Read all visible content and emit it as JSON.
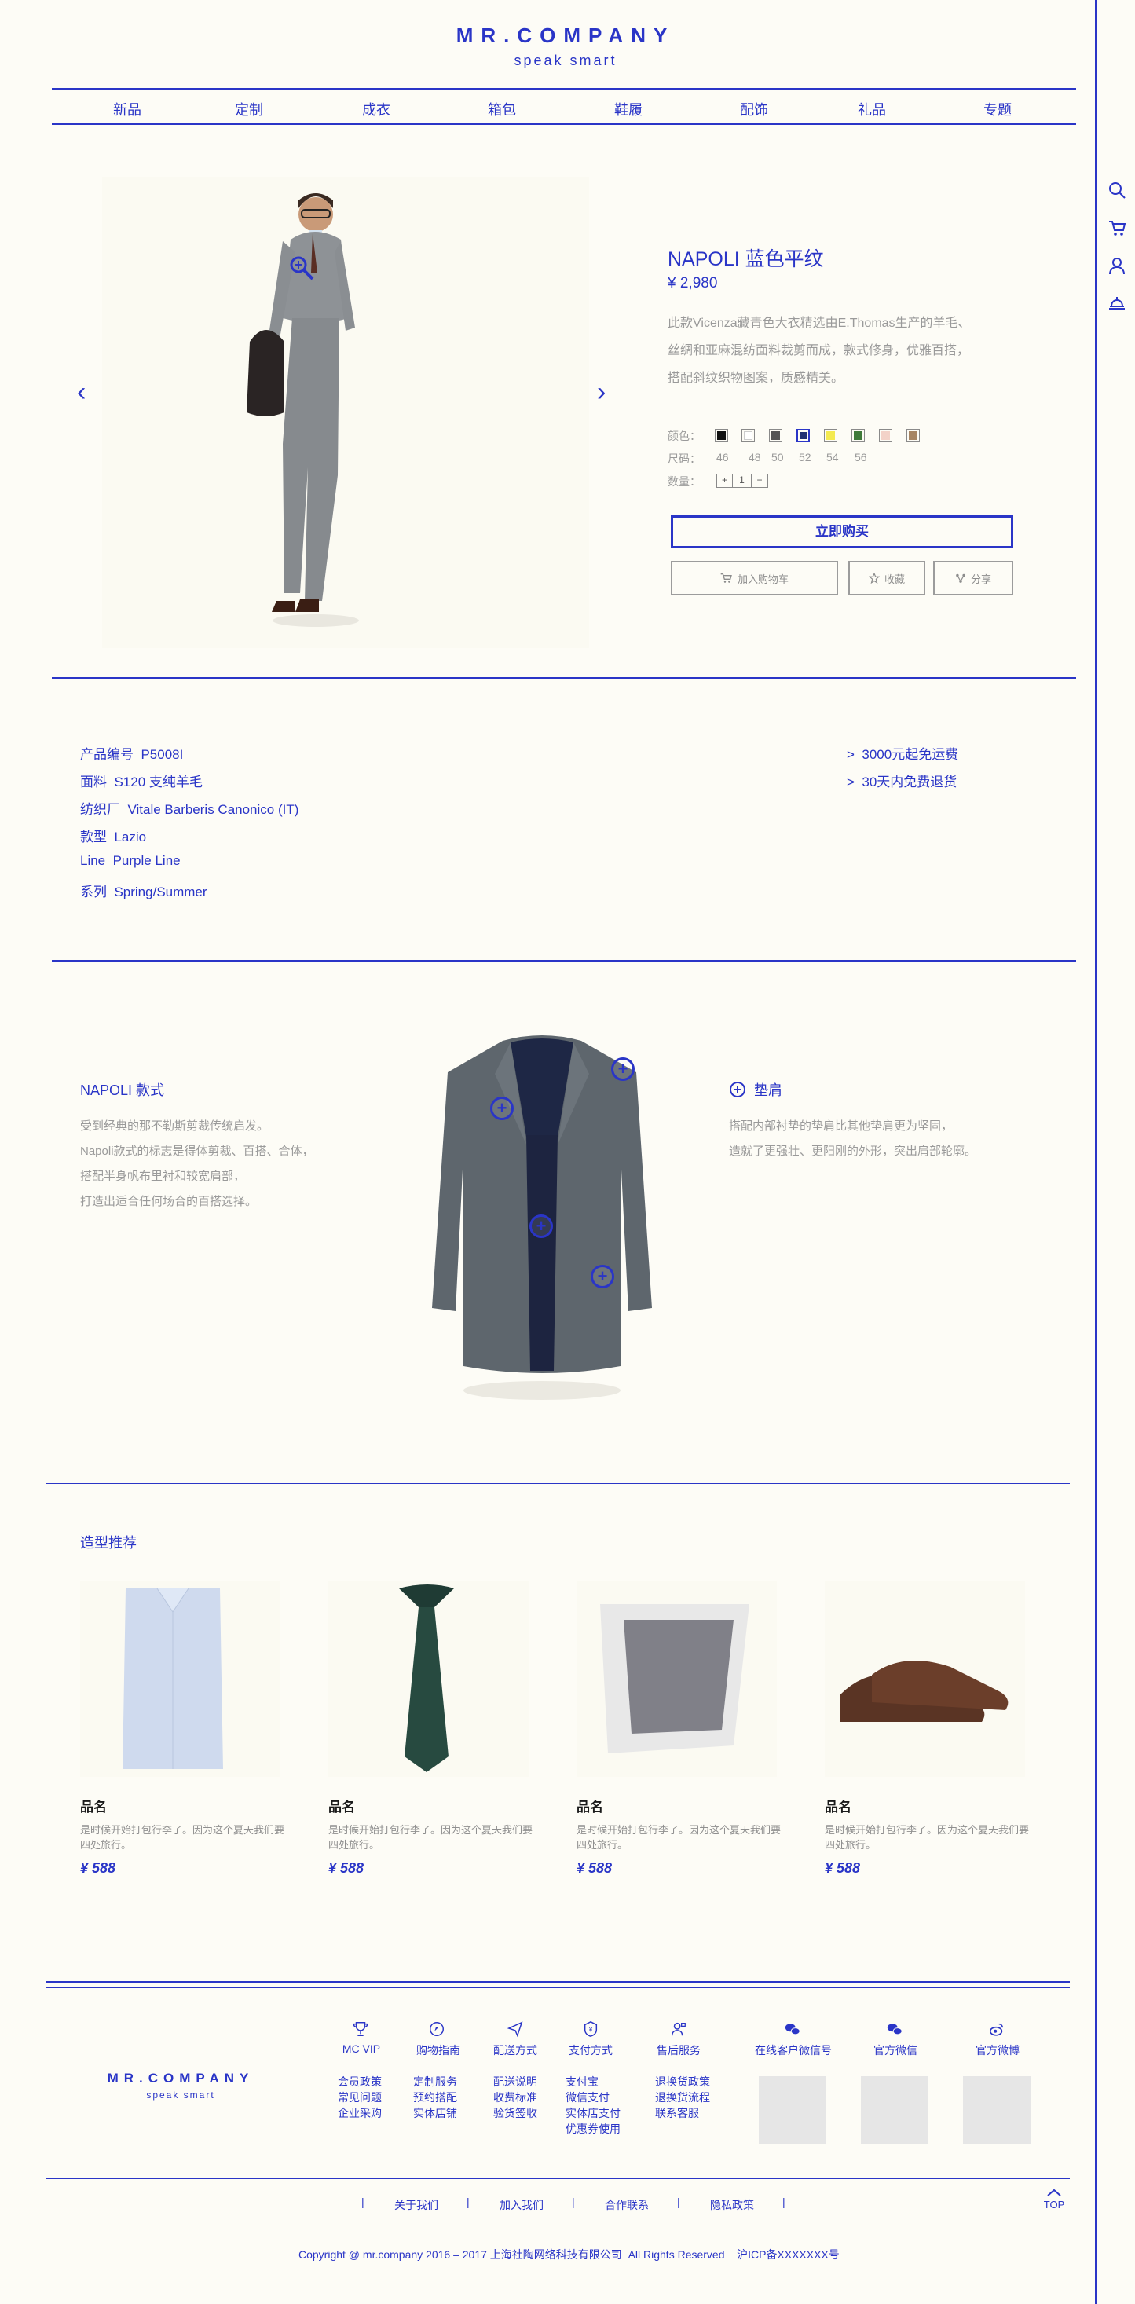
{
  "brand": {
    "logo": "MR.COMPANY",
    "tagline": "speak smart",
    "color": "#2a35c7"
  },
  "nav": [
    "新品",
    "定制",
    "成衣",
    "箱包",
    "鞋履",
    "配饰",
    "礼品",
    "专题"
  ],
  "rail_icons": [
    "search-icon",
    "cart-icon",
    "user-icon",
    "service-bell-icon"
  ],
  "product": {
    "name": "NAPOLI 蓝色平纹",
    "price": "¥ 2,980",
    "desc_lines": [
      "此款Vicenza藏青色大衣精选由E.Thomas生产的羊毛、",
      "丝绸和亚麻混纺面料裁剪而成，款式修身，优雅百搭，",
      "搭配斜纹织物图案，质感精美。"
    ],
    "color_label": "颜色：",
    "size_label": "尺码：",
    "qty_label": "数量：",
    "colors": [
      "#111111",
      "#ffffff",
      "#555555",
      "#1f2f73",
      "#f4ea50",
      "#3f7a3a",
      "#f3d2c8",
      "#a78563"
    ],
    "sizes": [
      "46",
      "48",
      "50",
      "52",
      "54",
      "56"
    ],
    "qty": {
      "minus": "+",
      "value": "1",
      "plus": "−"
    },
    "buy_now": "立即购买",
    "add_cart": "加入购物车",
    "favorite": "收藏",
    "share": "分享",
    "prev_arrow": "‹",
    "next_arrow": "›"
  },
  "specs": [
    {
      "label": "产品编号",
      "value": "P5008I"
    },
    {
      "label": "面料",
      "value": "S120 支纯羊毛"
    },
    {
      "label": "纺织厂",
      "value": "Vitale Barberis Canonico (IT)"
    },
    {
      "label": "款型",
      "value": "Lazio"
    },
    {
      "label": "Line",
      "value": "Purple Line"
    },
    {
      "label": "系列",
      "value": "Spring/Summer"
    }
  ],
  "perks": [
    "3000元起免运费",
    "30天内免费退货"
  ],
  "perk_marker": ">",
  "style": {
    "title": "NAPOLI 款式",
    "lines": [
      "受到经典的那不勒斯剪裁传统启发。",
      "Napoli款式的标志是得体剪裁、百搭、合体，",
      "搭配半身帆布里衬和较宽肩部，",
      "打造出适合任何场合的百搭选择。"
    ],
    "feature_title": "垫肩",
    "feature_lines": [
      "搭配内部衬垫的垫肩比其他垫肩更为坚固，",
      "造就了更强壮、更阳刚的外形，突出肩部轮廓。"
    ]
  },
  "recommend": {
    "title": "造型推荐",
    "items": [
      {
        "name": "品名",
        "desc": "是时候开始打包行李了。因为这个夏天我们要四处旅行。",
        "price": "¥ 588"
      },
      {
        "name": "品名",
        "desc": "是时候开始打包行李了。因为这个夏天我们要四处旅行。",
        "price": "¥ 588"
      },
      {
        "name": "品名",
        "desc": "是时候开始打包行李了。因为这个夏天我们要四处旅行。",
        "price": "¥ 588"
      },
      {
        "name": "品名",
        "desc": "是时候开始打包行李了。因为这个夏天我们要四处旅行。",
        "price": "¥ 588"
      }
    ]
  },
  "footer": {
    "cols": [
      {
        "title": "MC VIP",
        "links": [
          "会员政策",
          "常见问题",
          "企业采购"
        ]
      },
      {
        "title": "购物指南",
        "links": [
          "定制服务",
          "预约搭配",
          "实体店铺"
        ]
      },
      {
        "title": "配送方式",
        "links": [
          "配送说明",
          "收费标准",
          "验货签收"
        ]
      },
      {
        "title": "支付方式",
        "links": [
          "支付宝",
          "微信支付",
          "实体店支付",
          "优惠券使用"
        ]
      },
      {
        "title": "售后服务",
        "links": [
          "退换货政策",
          "退换货流程",
          "联系客服"
        ]
      }
    ],
    "social": [
      "在线客户微信号",
      "官方微信",
      "官方微博"
    ],
    "bottom_links": [
      "关于我们",
      "加入我们",
      "合作联系",
      "隐私政策"
    ],
    "divider": "|",
    "top": "TOP",
    "copyright": "Copyright @ mr.company 2016 – 2017 上海社陶网络科技有限公司  All Rights Reserved    沪ICP备XXXXXXX号"
  }
}
